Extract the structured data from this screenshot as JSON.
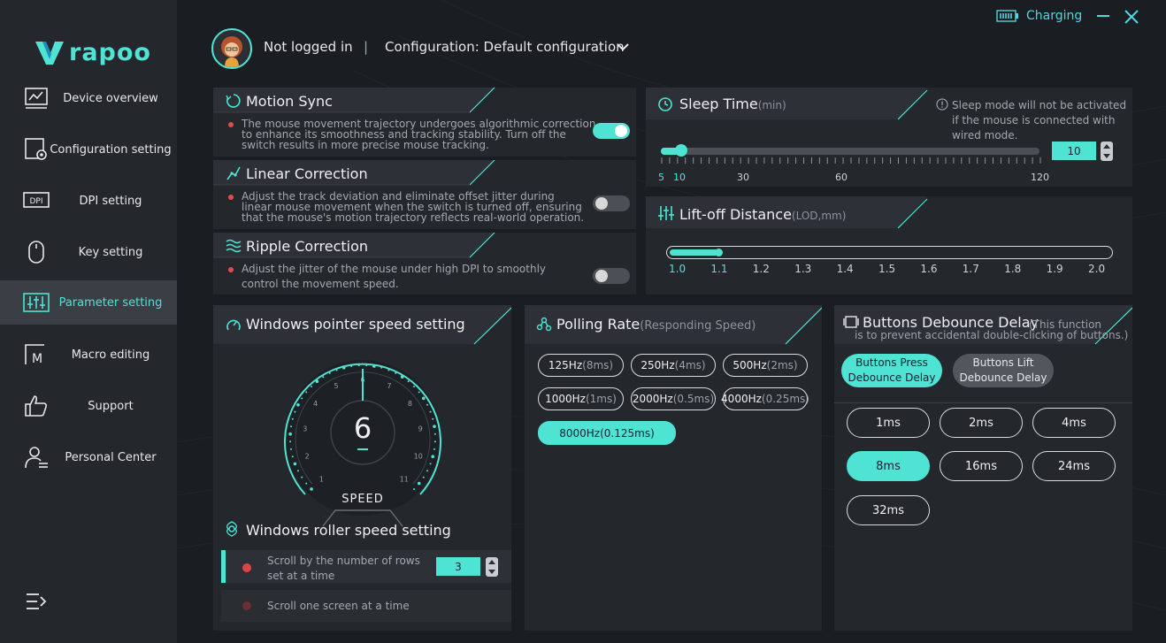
{
  "brand": {
    "logo_text": "rapoo"
  },
  "sidebar": {
    "items": [
      {
        "label": "Device overview",
        "icon": "device-overview-icon"
      },
      {
        "label": "Configuration setting",
        "icon": "configuration-icon"
      },
      {
        "label": "DPI setting",
        "icon": "dpi-icon",
        "icon_text": "DPI"
      },
      {
        "label": "Key setting",
        "icon": "mouse-icon"
      },
      {
        "label": "Parameter setting",
        "icon": "sliders-icon",
        "active": true
      },
      {
        "label": "Macro editing",
        "icon": "macro-icon",
        "icon_text": "M"
      },
      {
        "label": "Support",
        "icon": "thumbs-up-icon"
      },
      {
        "label": "Personal Center",
        "icon": "personal-icon"
      }
    ]
  },
  "header": {
    "user": "Not logged in",
    "separator": "|",
    "config": "Configuration: Default configuration",
    "charging": "Charging"
  },
  "colors": {
    "accent": "#4fe3d4",
    "panel": "#24272c",
    "bullet": "#e24b4b"
  },
  "motion_sync": {
    "title": "Motion Sync",
    "desc": [
      "The mouse movement trajectory undergoes algorithmic correction",
      "to enhance its smoothness and tracking stability. Turn off the",
      "switch results in more precise mouse tracking."
    ],
    "enabled": true
  },
  "linear_correction": {
    "title": "Linear Correction",
    "desc": [
      "Adjust the track deviation and eliminate offset jitter during",
      "linear mouse movement when the switch is turned off, ensuring",
      "that the mouse's motion trajectory reflects real-world operation."
    ],
    "enabled": false
  },
  "ripple_correction": {
    "title": "Ripple Correction",
    "desc": [
      "Adjust the jitter of the mouse under high DPI to smoothly",
      "control the movement speed."
    ],
    "enabled": false
  },
  "sleep_time": {
    "title": "Sleep Time",
    "unit": "(min)",
    "note": [
      "Sleep mode will not be activated",
      "if the mouse is connected with",
      "wired mode."
    ],
    "ticks": [
      "5",
      "10",
      "30",
      "60",
      "120"
    ],
    "value": "10",
    "slider_fraction": 0.04
  },
  "lift_off": {
    "title": "Lift-off Distance",
    "unit": "(LOD,mm)",
    "ticks": [
      "1.0",
      "1.1",
      "1.2",
      "1.3",
      "1.4",
      "1.5",
      "1.6",
      "1.7",
      "1.8",
      "1.9",
      "2.0"
    ],
    "selected_index": 1
  },
  "pointer_speed": {
    "title": "Windows pointer speed setting",
    "value": "6",
    "label": "SPEED",
    "dial_numbers": [
      "1",
      "2",
      "3",
      "4",
      "5",
      "6",
      "7",
      "8",
      "9",
      "10",
      "11"
    ]
  },
  "roller_speed": {
    "title": "Windows roller speed setting",
    "option_rows": [
      "Scroll by the number of rows",
      "set at a time"
    ],
    "rows_value": "3",
    "option_screen": "Scroll one screen at a time"
  },
  "polling_rate": {
    "title": "Polling Rate",
    "subtitle": "(Responding Speed)",
    "options": [
      {
        "rate": "125Hz",
        "ms": "(8ms)"
      },
      {
        "rate": "250Hz",
        "ms": "(4ms)"
      },
      {
        "rate": "500Hz",
        "ms": "(2ms)"
      },
      {
        "rate": "1000Hz",
        "ms": "(1ms)"
      },
      {
        "rate": "2000Hz",
        "ms": "(0.5ms)"
      },
      {
        "rate": "4000Hz",
        "ms": "(0.25ms)"
      },
      {
        "rate": "8000Hz",
        "ms": "(0.125ms)",
        "selected": true
      }
    ]
  },
  "debounce": {
    "title": "Buttons Debounce Delay",
    "note": [
      "(This function",
      "is to prevent accidental double-clicking of buttons.)"
    ],
    "press_tab": [
      "Buttons Press",
      "Debounce Delay"
    ],
    "lift_tab": [
      "Buttons Lift",
      "Debounce Delay"
    ],
    "options": [
      "1ms",
      "2ms",
      "4ms",
      "8ms",
      "16ms",
      "24ms",
      "32ms"
    ],
    "selected": "8ms"
  }
}
